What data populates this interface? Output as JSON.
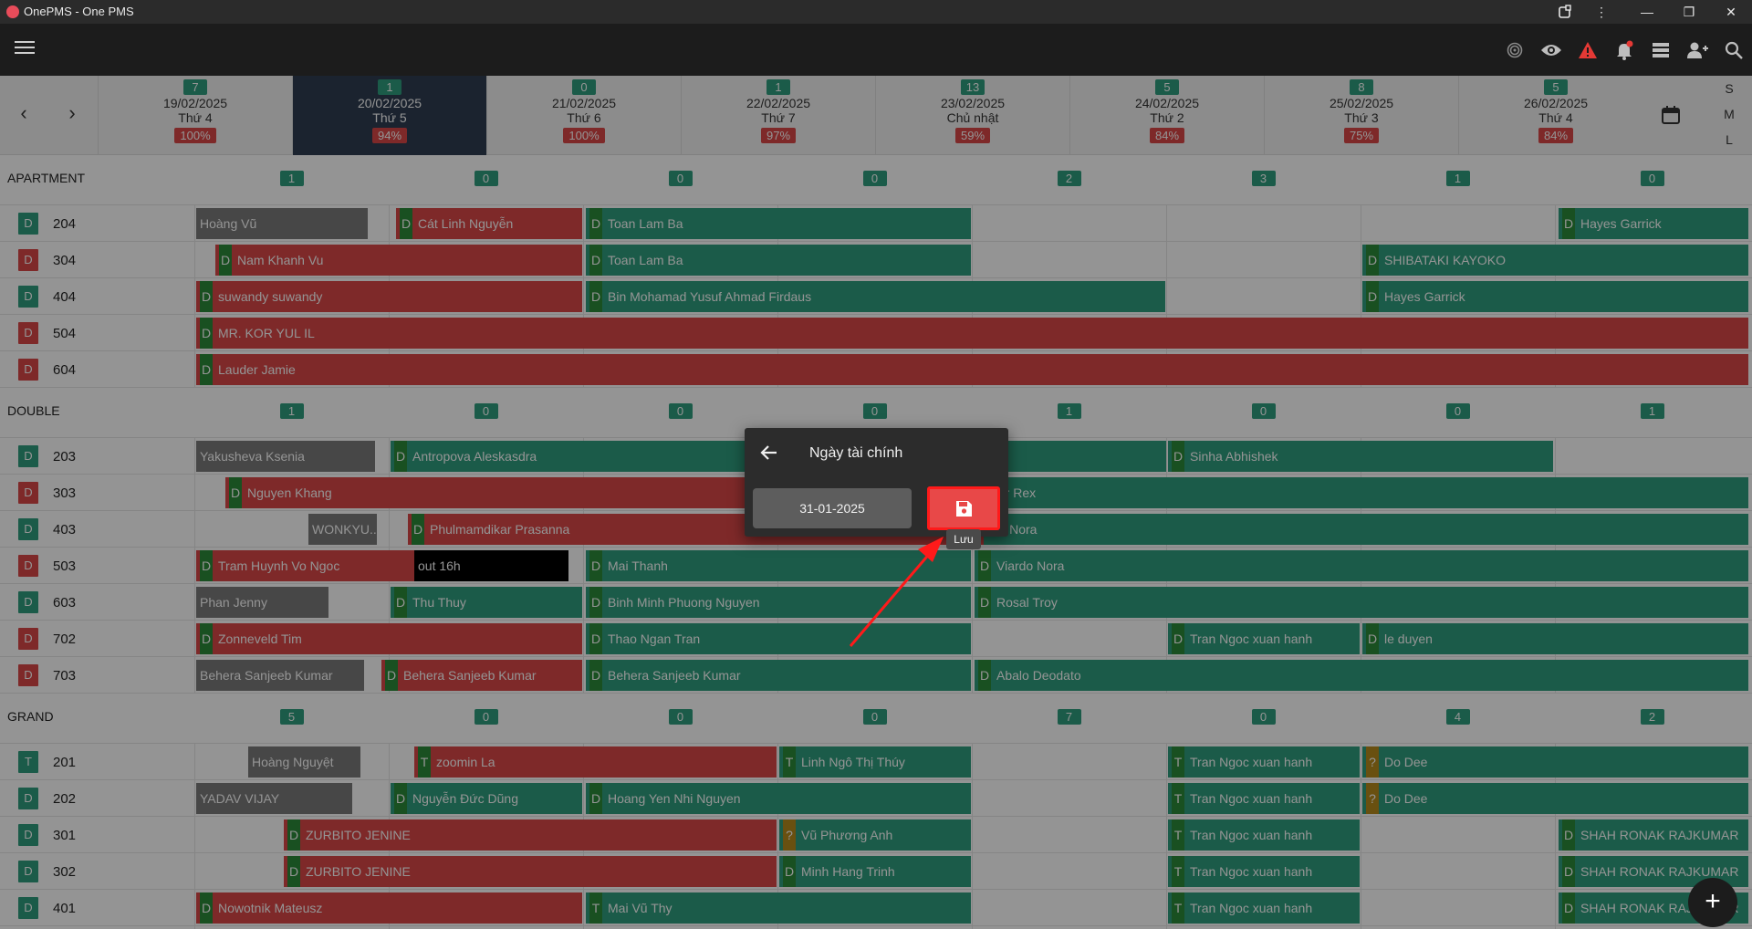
{
  "window": {
    "title": "OnePMS - One PMS"
  },
  "dates": [
    {
      "count": "7",
      "date": "19/02/2025",
      "weekday": "Thứ 4",
      "occupancy": "100%"
    },
    {
      "count": "1",
      "date": "20/02/2025",
      "weekday": "Thứ 5",
      "occupancy": "94%"
    },
    {
      "count": "0",
      "date": "21/02/2025",
      "weekday": "Thứ 6",
      "occupancy": "100%"
    },
    {
      "count": "1",
      "date": "22/02/2025",
      "weekday": "Thứ 7",
      "occupancy": "97%"
    },
    {
      "count": "13",
      "date": "23/02/2025",
      "weekday": "Chủ nhật",
      "occupancy": "59%"
    },
    {
      "count": "5",
      "date": "24/02/2025",
      "weekday": "Thứ 2",
      "occupancy": "84%"
    },
    {
      "count": "8",
      "date": "25/02/2025",
      "weekday": "Thứ 3",
      "occupancy": "75%"
    },
    {
      "count": "5",
      "date": "26/02/2025",
      "weekday": "Thứ 4",
      "occupancy": "84%"
    }
  ],
  "size_options": [
    "S",
    "M",
    "L"
  ],
  "groups": [
    {
      "name": "APARTMENT",
      "counts": [
        "1",
        "0",
        "0",
        "0",
        "2",
        "3",
        "1",
        "0"
      ],
      "rooms": [
        {
          "type": "D",
          "status": "clean",
          "number": "204",
          "bookings": [
            {
              "name": "Hoàng Vũ",
              "color": "gray",
              "tag": ""
            },
            {
              "name": "Cát Linh Nguyễn",
              "color": "red",
              "tag": "D"
            },
            {
              "name": "Toan Lam Ba",
              "color": "teal",
              "tag": "D"
            },
            {
              "name": "Hayes Garrick",
              "color": "teal",
              "tag": "D"
            }
          ]
        },
        {
          "type": "D",
          "status": "dirty",
          "number": "304",
          "bookings": [
            {
              "name": "Nam Khanh Vu",
              "color": "red",
              "tag": "D"
            },
            {
              "name": "Toan Lam Ba",
              "color": "teal",
              "tag": "D"
            },
            {
              "name": "SHIBATAKI KAYOKO",
              "color": "teal",
              "tag": "D"
            }
          ]
        },
        {
          "type": "D",
          "status": "clean",
          "number": "404",
          "bookings": [
            {
              "name": "suwandy suwandy",
              "color": "red",
              "tag": "D"
            },
            {
              "name": "Bin Mohamad Yusuf Ahmad Firdaus",
              "color": "teal",
              "tag": "D"
            },
            {
              "name": "Hayes Garrick",
              "color": "teal",
              "tag": "D"
            }
          ]
        },
        {
          "type": "D",
          "status": "dirty",
          "number": "504",
          "bookings": [
            {
              "name": "MR. KOR YUL IL",
              "color": "red",
              "tag": "D"
            }
          ]
        },
        {
          "type": "D",
          "status": "dirty",
          "number": "604",
          "bookings": [
            {
              "name": "Lauder Jamie",
              "color": "red",
              "tag": "D"
            }
          ]
        }
      ]
    },
    {
      "name": "DOUBLE",
      "counts": [
        "1",
        "0",
        "0",
        "0",
        "1",
        "0",
        "0",
        "1"
      ],
      "rooms": [
        {
          "type": "D",
          "status": "clean",
          "number": "203",
          "bookings": [
            {
              "name": "Yakusheva Ksenia",
              "color": "gray",
              "tag": ""
            },
            {
              "name": "Antropova Aleskasdra",
              "color": "teal",
              "tag": "D"
            },
            {
              "name": "Sinha Abhishek",
              "color": "teal",
              "tag": "D"
            }
          ]
        },
        {
          "type": "D",
          "status": "dirty",
          "number": "303",
          "bookings": [
            {
              "name": "Nguyen Khang",
              "color": "red",
              "tag": "D"
            },
            {
              "name": "kasiar Rex",
              "color": "teal",
              "tag": ""
            }
          ]
        },
        {
          "type": "D",
          "status": "clean",
          "number": "403",
          "bookings": [
            {
              "name": "WONKYU...",
              "color": "gray",
              "tag": ""
            },
            {
              "name": "Phulmamdikar Prasanna",
              "color": "red",
              "tag": "D"
            },
            {
              "name": "rdo Nora",
              "color": "teal",
              "tag": ""
            }
          ]
        },
        {
          "type": "D",
          "status": "dirty",
          "number": "503",
          "bookings": [
            {
              "name": "Tram Huynh Vo Ngoc",
              "color": "red",
              "tag": "D"
            },
            {
              "name": "out 16h",
              "color": "black",
              "tag": ""
            },
            {
              "name": "Mai Thanh",
              "color": "teal",
              "tag": "D"
            },
            {
              "name": "Viardo Nora",
              "color": "teal",
              "tag": "D"
            }
          ]
        },
        {
          "type": "D",
          "status": "clean",
          "number": "603",
          "bookings": [
            {
              "name": "Phan Jenny",
              "color": "gray",
              "tag": ""
            },
            {
              "name": "Thu Thuy",
              "color": "teal",
              "tag": "D"
            },
            {
              "name": "Binh Minh Phuong Nguyen",
              "color": "teal",
              "tag": "D"
            },
            {
              "name": "Rosal Troy",
              "color": "teal",
              "tag": "D"
            }
          ]
        },
        {
          "type": "D",
          "status": "dirty",
          "number": "702",
          "bookings": [
            {
              "name": "Zonneveld Tim",
              "color": "red",
              "tag": "D"
            },
            {
              "name": "Thao Ngan Tran",
              "color": "teal",
              "tag": "D"
            },
            {
              "name": "Tran Ngoc xuan hanh",
              "color": "teal",
              "tag": "D"
            },
            {
              "name": "le duyen",
              "color": "teal",
              "tag": "D"
            }
          ]
        },
        {
          "type": "D",
          "status": "dirty",
          "number": "703",
          "bookings": [
            {
              "name": "Behera Sanjeeb Kumar",
              "color": "gray",
              "tag": ""
            },
            {
              "name": "Behera Sanjeeb Kumar",
              "color": "red",
              "tag": "D"
            },
            {
              "name": "Behera Sanjeeb Kumar",
              "color": "teal",
              "tag": "D"
            },
            {
              "name": "Abalo Deodato",
              "color": "teal",
              "tag": "D"
            }
          ]
        }
      ]
    },
    {
      "name": "GRAND",
      "counts": [
        "5",
        "0",
        "0",
        "0",
        "7",
        "0",
        "4",
        "2"
      ],
      "rooms": [
        {
          "type": "T",
          "status": "clean",
          "number": "201",
          "bookings": [
            {
              "name": "Hoàng Nguyệt",
              "color": "gray",
              "tag": ""
            },
            {
              "name": "zoomin La",
              "color": "red",
              "tag": "T"
            },
            {
              "name": "Linh Ngô Thị Thúy",
              "color": "teal",
              "tag": "T"
            },
            {
              "name": "Tran Ngoc xuan hanh",
              "color": "teal",
              "tag": "T"
            },
            {
              "name": "Do Dee",
              "color": "teal",
              "tag": "?"
            }
          ]
        },
        {
          "type": "D",
          "status": "clean",
          "number": "202",
          "bookings": [
            {
              "name": "YADAV VIJAY",
              "color": "gray",
              "tag": ""
            },
            {
              "name": "Nguyễn Đức Dũng",
              "color": "teal",
              "tag": "D"
            },
            {
              "name": "Hoang Yen Nhi Nguyen",
              "color": "teal",
              "tag": "D"
            },
            {
              "name": "Tran Ngoc xuan hanh",
              "color": "teal",
              "tag": "T"
            },
            {
              "name": "Do Dee",
              "color": "teal",
              "tag": "?"
            }
          ]
        },
        {
          "type": "D",
          "status": "clean",
          "number": "301",
          "bookings": [
            {
              "name": "ZURBITO JENINE",
              "color": "red",
              "tag": "D"
            },
            {
              "name": "Vũ Phương Anh",
              "color": "teal",
              "tag": "?"
            },
            {
              "name": "Tran Ngoc xuan hanh",
              "color": "teal",
              "tag": "T"
            },
            {
              "name": "SHAH RONAK RAJKUMAR",
              "color": "teal",
              "tag": "D"
            }
          ]
        },
        {
          "type": "D",
          "status": "clean",
          "number": "302",
          "bookings": [
            {
              "name": "ZURBITO JENINE",
              "color": "red",
              "tag": "D"
            },
            {
              "name": "Minh Hang Trinh",
              "color": "teal",
              "tag": "D"
            },
            {
              "name": "Tran Ngoc xuan hanh",
              "color": "teal",
              "tag": "T"
            },
            {
              "name": "SHAH RONAK RAJKUMAR",
              "color": "teal",
              "tag": "D"
            }
          ]
        },
        {
          "type": "D",
          "status": "clean",
          "number": "401",
          "bookings": [
            {
              "name": "Nowotnik Mateusz",
              "color": "red",
              "tag": "D"
            },
            {
              "name": "Mai Vũ Thy",
              "color": "teal",
              "tag": "T"
            },
            {
              "name": "Tran Ngoc xuan hanh",
              "color": "teal",
              "tag": "T"
            },
            {
              "name": "SHAH RONAK RAJKUMAR",
              "color": "teal",
              "tag": "D"
            }
          ]
        }
      ]
    }
  ],
  "dialog": {
    "title": "Ngày tài chính",
    "date_value": "31-01-2025",
    "save_tooltip": "Lưu"
  },
  "fab_label": "+"
}
